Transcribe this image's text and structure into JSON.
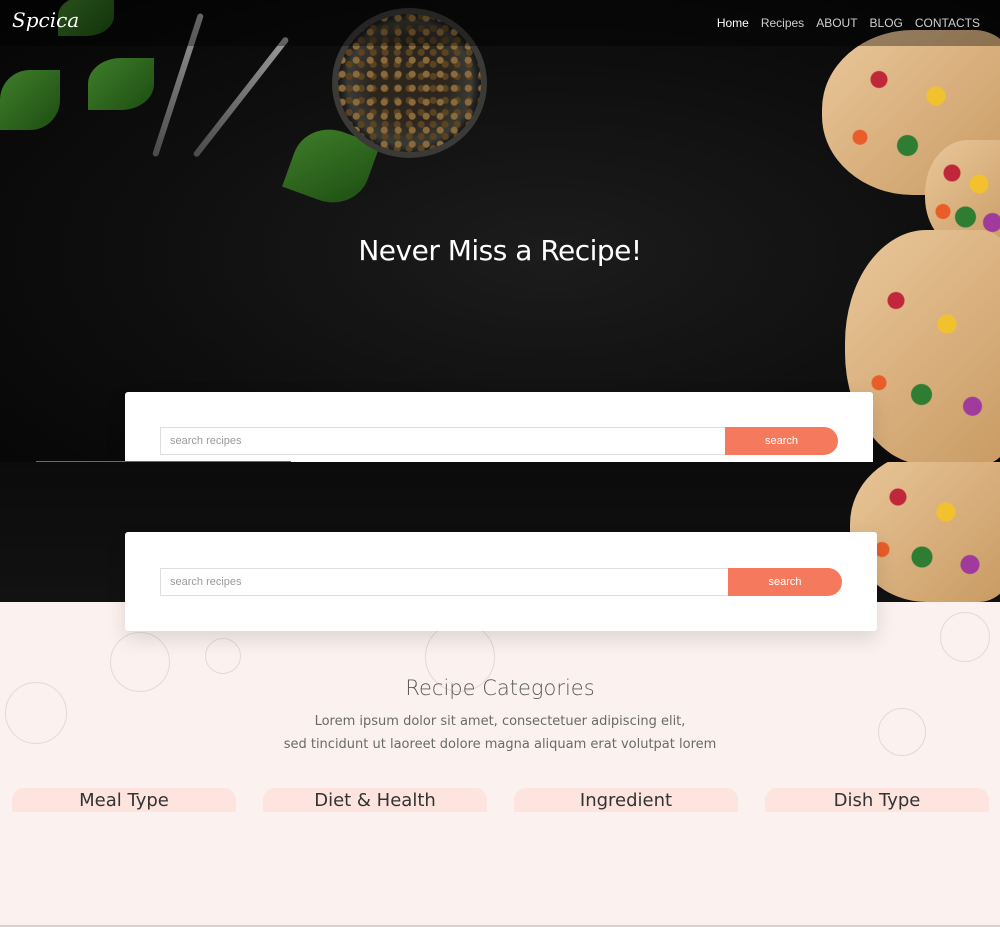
{
  "brand": {
    "logo_text": "Spcica"
  },
  "nav": {
    "items": [
      {
        "label": "Home",
        "active": true
      },
      {
        "label": "Recipes",
        "active": false
      },
      {
        "label": "ABOUT",
        "active": false
      },
      {
        "label": "BLOG",
        "active": false
      },
      {
        "label": "CONTACTS",
        "active": false
      }
    ]
  },
  "hero": {
    "title": "Never Miss a Recipe!"
  },
  "search": {
    "placeholder": "search recipes",
    "button_label": "search"
  },
  "categories": {
    "title": "Recipe Categories",
    "description_line1": "Lorem ipsum dolor sit amet, consectetuer adipiscing elit,",
    "description_line2": "sed tincidunt ut laoreet dolore magna aliquam erat volutpat lorem",
    "tabs": [
      {
        "label": "Meal Type"
      },
      {
        "label": "Diet & Health"
      },
      {
        "label": "Ingredient"
      },
      {
        "label": "Dish Type"
      }
    ]
  },
  "colors": {
    "accent": "#f5795d",
    "hero_bg": "#0e0e0e",
    "section_bg": "#fbf1ee",
    "tab_bg": "#fde4de"
  }
}
